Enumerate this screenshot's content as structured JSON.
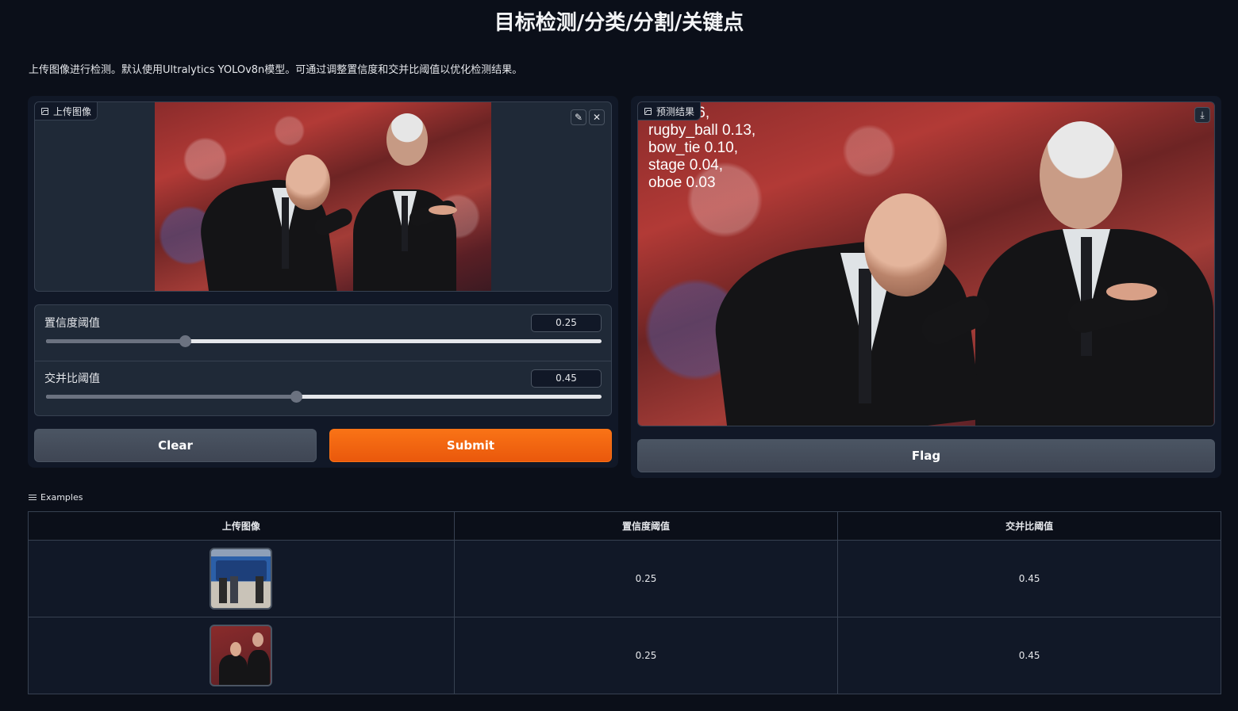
{
  "title": "目标检测/分类/分割/关键点",
  "description": "上传图像进行检测。默认使用Ultralytics YOLOv8n模型。可通过调整置信度和交并比阈值以优化检测结果。",
  "input_image": {
    "label": "上传图像",
    "edit_icon": "pencil-icon",
    "close_icon": "close-icon"
  },
  "sliders": [
    {
      "label": "置信度阈值",
      "value": "0.25",
      "fraction": 0.25
    },
    {
      "label": "交并比阈值",
      "value": "0.45",
      "fraction": 0.45
    }
  ],
  "buttons": {
    "clear": "Clear",
    "submit": "Submit",
    "flag": "Flag"
  },
  "output_image": {
    "label": "预测结果",
    "download_icon": "download-icon",
    "overlay_lines": [
      "suit 0.16,",
      "rugby_ball 0.13,",
      "bow_tie 0.10,",
      "stage 0.04,",
      "oboe 0.03"
    ]
  },
  "examples": {
    "label": "Examples",
    "headers": [
      "上传图像",
      "置信度阈值",
      "交并比阈值"
    ],
    "rows": [
      {
        "confidence": "0.25",
        "iou": "0.45"
      },
      {
        "confidence": "0.25",
        "iou": "0.45"
      }
    ]
  },
  "colors": {
    "background": "#0b0f19",
    "panel": "#111827",
    "accent": "#f97316"
  }
}
